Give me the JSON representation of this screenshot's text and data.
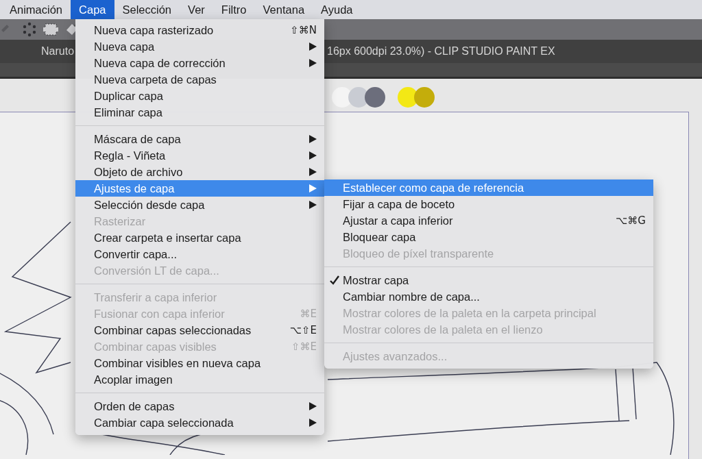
{
  "menubar": [
    {
      "label": "Animación",
      "selected": false
    },
    {
      "label": "Capa",
      "selected": true
    },
    {
      "label": "Selección",
      "selected": false
    },
    {
      "label": "Ver",
      "selected": false
    },
    {
      "label": "Filtro",
      "selected": false
    },
    {
      "label": "Ventana",
      "selected": false
    },
    {
      "label": "Ayuda",
      "selected": false
    }
  ],
  "window": {
    "title_left": "Naruto",
    "title_right": "16px 600dpi 23.0%)  - CLIP STUDIO PAINT EX"
  },
  "swatches": [
    {
      "color": "#f4f4f4"
    },
    {
      "color": "#c9ccd3"
    },
    {
      "color": "#6c6e7c"
    },
    {
      "color": "#f3e815"
    },
    {
      "color": "#c4ad0b"
    }
  ],
  "menu": {
    "sections": [
      [
        {
          "label": "Nueva capa rasterizado",
          "shortcut": "⇧⌘N",
          "has_submenu": false,
          "disabled": false,
          "selected": false
        },
        {
          "label": "Nueva capa",
          "has_submenu": true,
          "disabled": false,
          "selected": false
        },
        {
          "label": "Nueva capa de corrección",
          "has_submenu": true,
          "disabled": false,
          "selected": false
        },
        {
          "label": "Nueva carpeta de capas",
          "has_submenu": false,
          "disabled": false,
          "selected": false
        },
        {
          "label": "Duplicar capa",
          "has_submenu": false,
          "disabled": false,
          "selected": false
        },
        {
          "label": "Eliminar capa",
          "has_submenu": false,
          "disabled": false,
          "selected": false
        }
      ],
      [
        {
          "label": "Máscara de capa",
          "has_submenu": true,
          "disabled": false,
          "selected": false
        },
        {
          "label": "Regla - Viñeta",
          "has_submenu": true,
          "disabled": false,
          "selected": false
        },
        {
          "label": "Objeto de archivo",
          "has_submenu": true,
          "disabled": false,
          "selected": false
        },
        {
          "label": "Ajustes de capa",
          "has_submenu": true,
          "disabled": false,
          "selected": true
        },
        {
          "label": "Selección desde capa",
          "has_submenu": true,
          "disabled": false,
          "selected": false
        },
        {
          "label": "Rasterizar",
          "has_submenu": false,
          "disabled": true,
          "selected": false
        },
        {
          "label": "Crear carpeta e insertar capa",
          "has_submenu": false,
          "disabled": false,
          "selected": false
        },
        {
          "label": "Convertir capa...",
          "has_submenu": false,
          "disabled": false,
          "selected": false
        },
        {
          "label": "Conversión LT de capa...",
          "has_submenu": false,
          "disabled": true,
          "selected": false
        }
      ],
      [
        {
          "label": "Transferir a capa inferior",
          "has_submenu": false,
          "disabled": true,
          "selected": false
        },
        {
          "label": "Fusionar con capa inferior",
          "shortcut": "⌘E",
          "has_submenu": false,
          "disabled": true,
          "selected": false
        },
        {
          "label": "Combinar capas seleccionadas",
          "shortcut": "⌥⇧E",
          "has_submenu": false,
          "disabled": false,
          "selected": false
        },
        {
          "label": "Combinar capas visibles",
          "shortcut": "⇧⌘E",
          "has_submenu": false,
          "disabled": true,
          "selected": false
        },
        {
          "label": "Combinar visibles en nueva capa",
          "has_submenu": false,
          "disabled": false,
          "selected": false
        },
        {
          "label": "Acoplar imagen",
          "has_submenu": false,
          "disabled": false,
          "selected": false
        }
      ],
      [
        {
          "label": "Orden de capas",
          "has_submenu": true,
          "disabled": false,
          "selected": false
        },
        {
          "label": "Cambiar capa seleccionada",
          "has_submenu": true,
          "disabled": false,
          "selected": false
        }
      ]
    ]
  },
  "submenu": {
    "sections": [
      [
        {
          "label": "Establecer como capa de referencia",
          "disabled": false,
          "selected": true,
          "checked": false
        },
        {
          "label": "Fijar a capa de boceto",
          "disabled": false,
          "selected": false,
          "checked": false
        },
        {
          "label": "Ajustar a capa inferior",
          "shortcut": "⌥⌘G",
          "disabled": false,
          "selected": false,
          "checked": false
        },
        {
          "label": "Bloquear capa",
          "disabled": false,
          "selected": false,
          "checked": false
        },
        {
          "label": "Bloqueo de píxel transparente",
          "disabled": true,
          "selected": false,
          "checked": false
        }
      ],
      [
        {
          "label": "Mostrar capa",
          "disabled": false,
          "selected": false,
          "checked": true
        },
        {
          "label": "Cambiar nombre de capa...",
          "disabled": false,
          "selected": false,
          "checked": false
        },
        {
          "label": "Mostrar colores de la paleta en la carpeta principal",
          "disabled": true,
          "selected": false,
          "checked": false
        },
        {
          "label": "Mostrar colores de la paleta en el lienzo",
          "disabled": true,
          "selected": false,
          "checked": false
        }
      ],
      [
        {
          "label": "Ajustes avanzados...",
          "disabled": true,
          "selected": false,
          "checked": false
        }
      ]
    ]
  }
}
